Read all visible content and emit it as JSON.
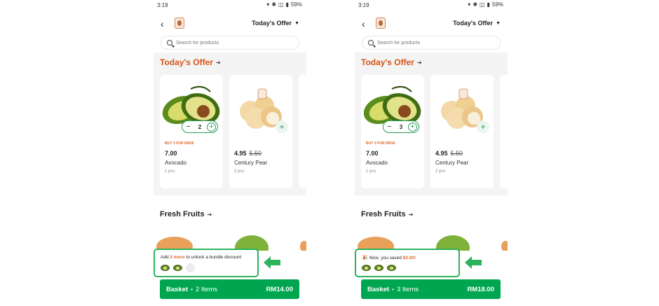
{
  "screens": [
    {
      "status": {
        "time": "3:19",
        "battery": "59%"
      },
      "header": {
        "offer_select": "Today's Offer"
      },
      "search": {
        "placeholder": "Search for products"
      },
      "offers": {
        "title": "Today's Offer",
        "products": [
          {
            "promo": "BUY 3 FOR RM18",
            "price": "7.00",
            "old_price": "",
            "name": "Avocado",
            "qty_text": "1 pcs",
            "stepper_qty": "2"
          },
          {
            "promo": "",
            "price": "4.95",
            "old_price": "5.50",
            "name": "Century Pear",
            "qty_text": "2 pcs",
            "stepper_qty": ""
          }
        ]
      },
      "fresh": {
        "title": "Fresh Fruits"
      },
      "bundle": {
        "prefix": "Add ",
        "highlight": "2 more",
        "suffix": " to unlock a bundle discount",
        "filled": 2,
        "total": 3
      },
      "basket": {
        "label": "Basket",
        "items": "2 Items",
        "total": "RM14.00"
      }
    },
    {
      "status": {
        "time": "3:19",
        "battery": "59%"
      },
      "header": {
        "offer_select": "Today's Offer"
      },
      "search": {
        "placeholder": "Search for products"
      },
      "offers": {
        "title": "Today's Offer",
        "products": [
          {
            "promo": "BUY 3 FOR RM18",
            "price": "7.00",
            "old_price": "",
            "name": "Avocado",
            "qty_text": "1 pcs",
            "stepper_qty": "3"
          },
          {
            "promo": "",
            "price": "4.95",
            "old_price": "5.50",
            "name": "Century Pear",
            "qty_text": "2 pcs",
            "stepper_qty": ""
          }
        ]
      },
      "fresh": {
        "title": "Fresh Fruits"
      },
      "bundle": {
        "prefix": "Nice, you saved ",
        "highlight": "$3.00!",
        "suffix": "",
        "filled": 3,
        "total": 3
      },
      "basket": {
        "label": "Basket",
        "items": "3 Items",
        "total": "RM18.00"
      }
    }
  ],
  "colors": {
    "brand_green": "#00a64f",
    "accent_orange": "#d45517",
    "highlight_border": "#2db35b"
  },
  "icons": [
    "back-chevron-icon",
    "store-logo-icon",
    "caret-down-icon",
    "search-icon",
    "plus-icon",
    "minus-icon",
    "arrow-right-icon",
    "avocado-icon",
    "party-popper-icon",
    "green-arrow-icon"
  ]
}
